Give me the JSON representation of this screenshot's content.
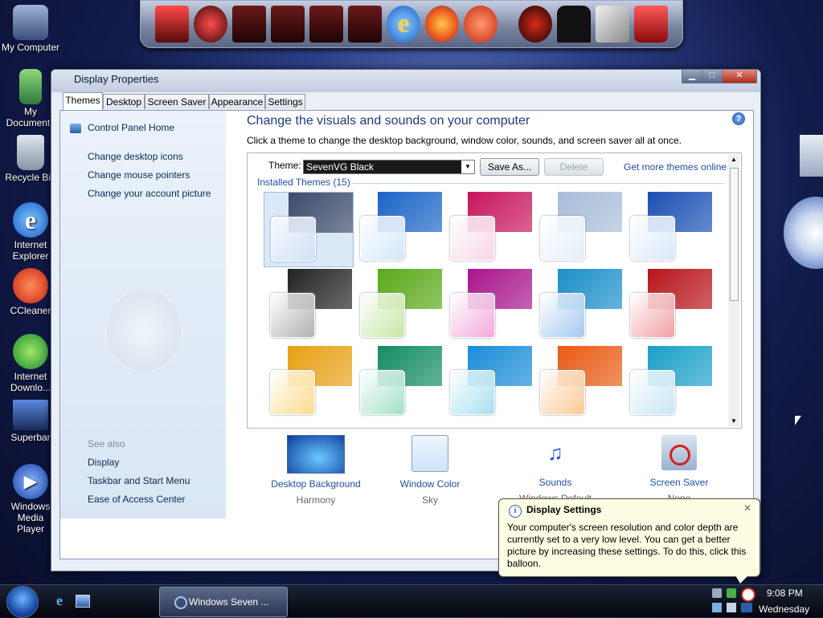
{
  "desktop_icons": [
    {
      "name": "desktop-icon-my-computer",
      "label": "My Computer"
    },
    {
      "name": "desktop-icon-my-documents",
      "label": "My Documents"
    },
    {
      "name": "desktop-icon-recycle-bin",
      "label": "Recycle Bin"
    },
    {
      "name": "desktop-icon-internet-explorer",
      "label": "Internet Explorer"
    },
    {
      "name": "desktop-icon-ccleaner",
      "label": "CCleaner"
    },
    {
      "name": "desktop-icon-internet-download",
      "label": "Internet Downlo..."
    },
    {
      "name": "desktop-icon-superbar",
      "label": "Superbar"
    },
    {
      "name": "desktop-icon-windows-media-player",
      "label": "Windows Media Player"
    }
  ],
  "window": {
    "title": "Display Properties",
    "tabs": [
      "Themes",
      "Desktop",
      "Screen Saver",
      "Appearance",
      "Settings"
    ],
    "control_panel_home": "Control Panel Home",
    "left_links": [
      "Change desktop icons",
      "Change mouse pointers",
      "Change your account picture"
    ],
    "see_also_label": "See also",
    "see_also_links": [
      "Display",
      "Taskbar and Start Menu",
      "Ease of Access Center"
    ],
    "header": "Change the visuals and sounds on your computer",
    "subtext": "Click a theme to change the desktop background, window color, sounds, and screen saver all at once.",
    "theme_label": "Theme:",
    "theme_value": "SevenVG Black",
    "save_as": "Save As...",
    "delete": "Delete",
    "get_more": "Get more themes online",
    "installed_label": "Installed Themes (15)",
    "bottom": [
      {
        "label": "Desktop Background",
        "value": "Harmony"
      },
      {
        "label": "Window Color",
        "value": "Sky"
      },
      {
        "label": "Sounds",
        "value": "Windows Default"
      },
      {
        "label": "Screen Saver",
        "value": "None"
      }
    ]
  },
  "themes": [
    {
      "bg": "#3a4a6a",
      "gl": "#cfe0f7"
    },
    {
      "bg": "#1a64c8",
      "gl": "#d4e6fa"
    },
    {
      "bg": "#c8145a",
      "gl": "#f8d6e6"
    },
    {
      "bg": "#a8bcd8",
      "gl": "#e4eef8"
    },
    {
      "bg": "#1a4fb4",
      "gl": "#d8e8fa"
    },
    {
      "bg": "#222222",
      "gl": "#b0b0b0"
    },
    {
      "bg": "#5aa818",
      "gl": "#c8e6a4"
    },
    {
      "bg": "#a8148c",
      "gl": "#f2a8dc"
    },
    {
      "bg": "#1a8ec8",
      "gl": "#a4c8f0"
    },
    {
      "bg": "#b8141a",
      "gl": "#f0a0a4"
    },
    {
      "bg": "#e8a014",
      "gl": "#fadc8c"
    },
    {
      "bg": "#148c64",
      "gl": "#a4e0c8"
    },
    {
      "bg": "#1a8cd8",
      "gl": "#a8e0ee"
    },
    {
      "bg": "#e85a14",
      "gl": "#fac894"
    },
    {
      "bg": "#1aa0c8",
      "gl": "#c8e6f4"
    }
  ],
  "balloon": {
    "title": "Display Settings",
    "text": "Your computer's screen resolution and color depth are currently set to a very low level. You can get a better picture by increasing these settings. To do this, click this balloon."
  },
  "taskbar": {
    "task_label": "Windows Seven ...",
    "time": "9:08 PM",
    "day": "Wednesday"
  }
}
